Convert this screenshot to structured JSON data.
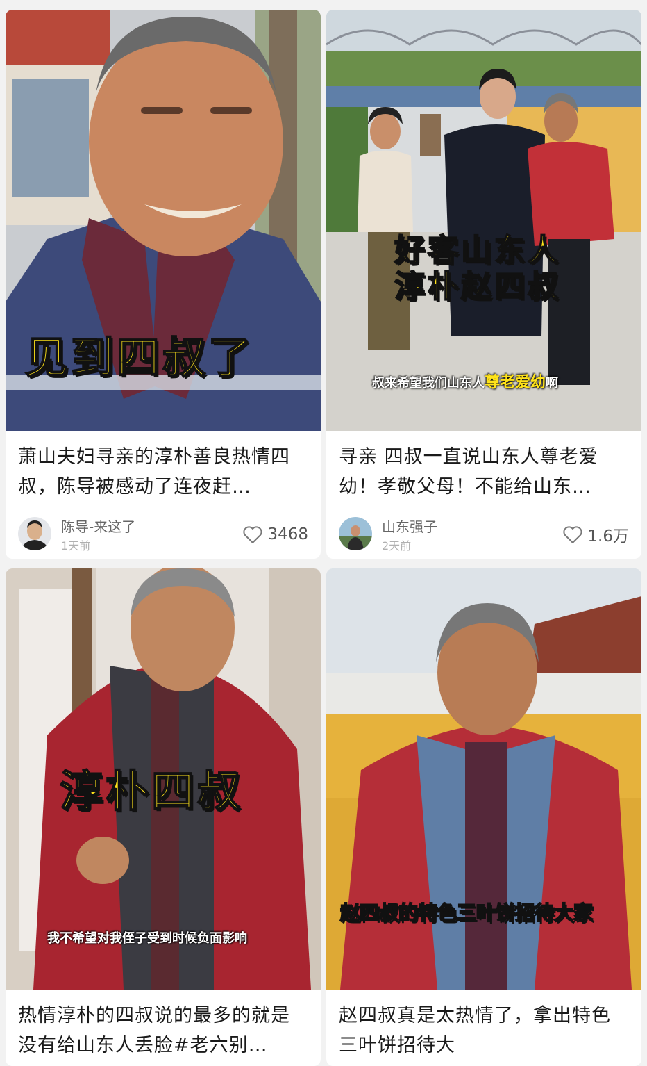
{
  "cards": [
    {
      "overlay": "见到四叔了",
      "title": "萧山夫妇寻亲的淳朴善良热情四叔，陈导被感动了连夜赶…",
      "author": "陈导-来这了",
      "time": "1天前",
      "likes": "3468"
    },
    {
      "overlay_line1": "好客山东人",
      "overlay_line2": "淳朴赵四叔",
      "subtitle_pre": "叔来希望我们山东人",
      "subtitle_hl": "尊老爱幼",
      "subtitle_post": "啊",
      "title": "寻亲 四叔一直说山东人尊老爱幼！孝敬父母！不能给山东…",
      "author": "山东强子",
      "time": "2天前",
      "likes": "1.6万"
    },
    {
      "overlay": "淳朴四叔",
      "subtitle": "我不希望对我侄子受到时候负面影响",
      "title": "热情淳朴的四叔说的最多的就是没有给山东人丢脸#老六别…"
    },
    {
      "overlay": "赵四叔的特色三叶饼招待大家",
      "title": "赵四叔真是太热情了，拿出特色三叶饼招待大"
    }
  ]
}
